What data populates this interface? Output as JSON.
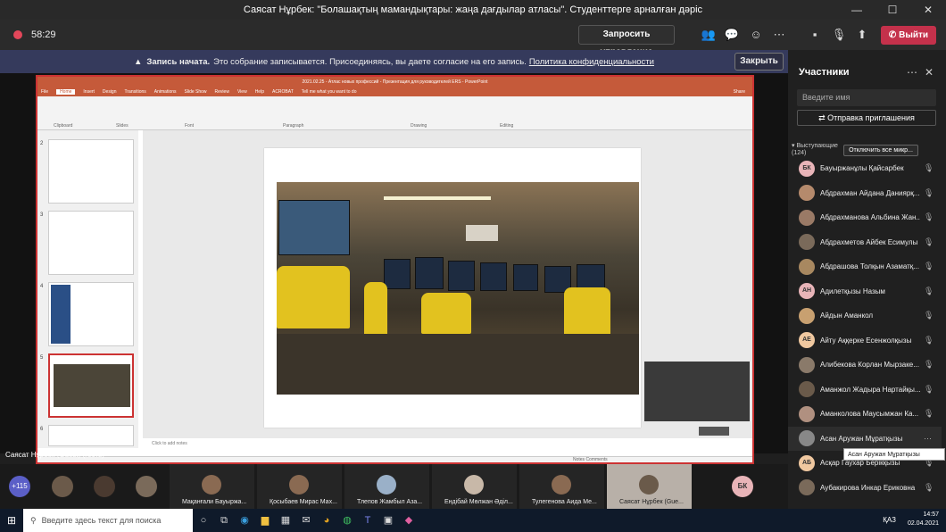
{
  "window": {
    "title": "Саясат Нұрбек: \"Болашақтың мамандықтары: жаңа дағдылар атласы\". Студенттерге арналған дәріс",
    "min": "—",
    "max": "☐",
    "close": "✕"
  },
  "toolbar": {
    "timer": "58:29",
    "request_control": "Запросить управление",
    "leave": "Выйти",
    "colors": {
      "leave": "#c4314b",
      "record": "#e3475a"
    }
  },
  "banner": {
    "bold": "Запись начата.",
    "text": "Это собрание записывается. Присоединяясь, вы даете согласие на его запись.",
    "link": "Политика конфиденциальности",
    "close": "Закрыть"
  },
  "ppt": {
    "title": "2021.02.25 - Атлас новых профессий - Презентация для руководителей ERS - PowerPoint",
    "menu": [
      "File",
      "Home",
      "Insert",
      "Design",
      "Transitions",
      "Animations",
      "Slide Show",
      "Review",
      "View",
      "Help",
      "ACROBAT"
    ],
    "tell_me": "Tell me what you want to do",
    "share": "Share",
    "groups": [
      "Clipboard",
      "Slides",
      "Font",
      "Paragraph",
      "Drawing",
      "Editing"
    ],
    "thumb_numbers": [
      "2",
      "3",
      "4",
      "5",
      "6"
    ],
    "notes": "Click to add notes",
    "status": "Notes  Comments"
  },
  "presenter_name": "Саясат Нұрбек (Guest) (гость)",
  "panel": {
    "title": "Участники",
    "search_placeholder": "Введите имя",
    "invite": "Отправка приглашения",
    "presenters_label": "Выступающие",
    "presenters_count": "(124)",
    "mute_all": "Отключить все микр...",
    "participants": [
      {
        "initials": "БК",
        "name": "Бауыржанұлы Қайсарбек",
        "color": "#e8b4b8"
      },
      {
        "initials": "",
        "name": "Абдрахман Айдана Даниярқ...",
        "color": "#b58a6c"
      },
      {
        "initials": "",
        "name": "Абдрахманова Альбина Жан...",
        "color": "#9a7a66"
      },
      {
        "initials": "",
        "name": "Абдрахметов Айбек Есимулы",
        "color": "#7a6a5a"
      },
      {
        "initials": "",
        "name": "Абдрашова Толқын Азаматқ...",
        "color": "#a88860"
      },
      {
        "initials": "АН",
        "name": "Адилетқызы Назым",
        "color": "#e8b4b8"
      },
      {
        "initials": "",
        "name": "Айдын Аманкол",
        "color": "#c8a070"
      },
      {
        "initials": "АЕ",
        "name": "Айту Аққерке Есенжолқызы",
        "color": "#f0c8a0"
      },
      {
        "initials": "",
        "name": "Алибекова Корлан Мырзаке...",
        "color": "#8a7a6a"
      },
      {
        "initials": "",
        "name": "Аманжол Жадыра Нартайқы...",
        "color": "#6a5a4a"
      },
      {
        "initials": "",
        "name": "Аманколова Маусымжан Ка...",
        "color": "#b09080"
      },
      {
        "initials": "",
        "name": "Асан Аружан Мұратқызы",
        "color": "#888888"
      },
      {
        "initials": "АБ",
        "name": "Асқар Гаухар Берікқызы",
        "color": "#f0c8a0"
      },
      {
        "initials": "",
        "name": "Аубакирова Инкар Ериковна",
        "color": "#7a6a5a"
      }
    ],
    "tooltip": "Асан Аружан Мұратқызы"
  },
  "strip": {
    "more": "+115",
    "tiles": [
      {
        "name": "Мақанғали Бауыржа..."
      },
      {
        "name": "Қосыбаев Мирас Мах..."
      },
      {
        "name": "Тлепов Жамбыл Аза..."
      },
      {
        "name": "Ендібай Мөлжан Әділ..."
      },
      {
        "name": "Тулегенова Аида Ме..."
      },
      {
        "name": "Саясат Нұрбек (Gue..."
      }
    ],
    "last_initials": "БК"
  },
  "taskbar": {
    "search": "Введите здесь текст для поиска",
    "lang": "ҚАЗ",
    "time": "14:57",
    "date": "02.04.2021"
  }
}
